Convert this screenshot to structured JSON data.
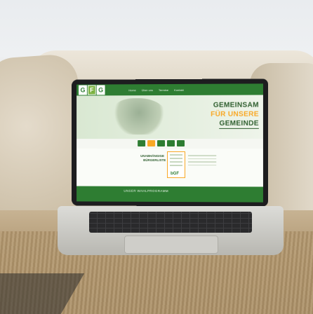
{
  "website": {
    "logo_letters": [
      "G",
      "F",
      "G"
    ],
    "nav_items": [
      "Home",
      "Über uns",
      "Termine",
      "Kontakt"
    ],
    "headline": {
      "line1": "GEMEINSAM",
      "line2_prefix": "FÜR",
      "line2": "UNSERE",
      "line3": "GEMEINDE"
    },
    "label_left_1": "UNABHÄNGIGE",
    "label_left_2": "BÜRGERLISTE",
    "mini_logo": "bGF",
    "footer_link": "UNSER WAHLPROGRAMM"
  },
  "colors": {
    "brand_green": "#2e7d32",
    "accent_yellow": "#f9a825"
  }
}
